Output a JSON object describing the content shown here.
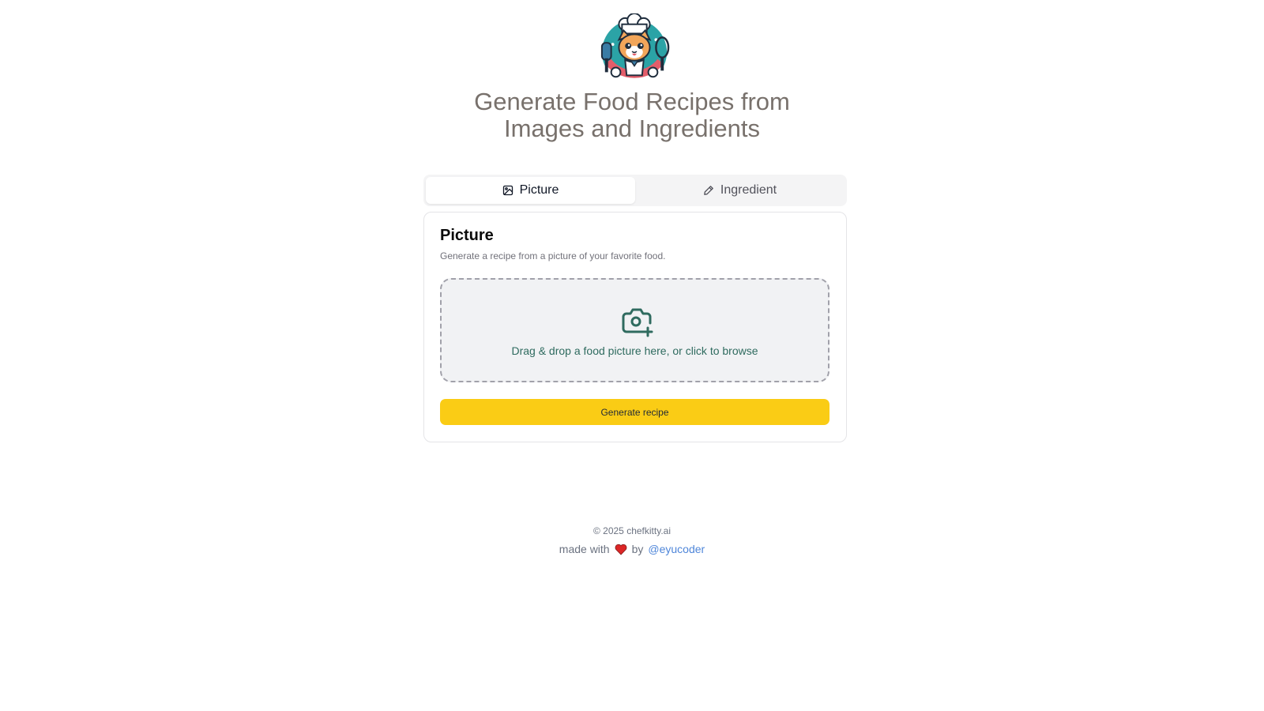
{
  "header": {
    "logo_icon": "chef-cat-logo",
    "title_line1": "Generate Food Recipes from",
    "title_line2": "Images and Ingredients"
  },
  "tabs": [
    {
      "label": "Picture",
      "icon": "image-icon",
      "active": true
    },
    {
      "label": "Ingredient",
      "icon": "pencil-icon",
      "active": false
    }
  ],
  "card": {
    "title": "Picture",
    "description": "Generate a recipe from a picture of your favorite food.",
    "dropzone": {
      "icon": "camera-plus-icon",
      "text": "Drag & drop a food picture here, or click to browse"
    },
    "generate_label": "Generate recipe"
  },
  "footer": {
    "copyright": "© 2025 chefkitty.ai",
    "made_with": "made with",
    "heart_icon": "heart-icon",
    "by": "by",
    "author": "@eyucoder"
  },
  "colors": {
    "title": "#78716c",
    "accent_button": "#facc15",
    "dropzone_text": "#2f6b5f",
    "link": "#4f86d9",
    "heart": "#dc2626"
  }
}
